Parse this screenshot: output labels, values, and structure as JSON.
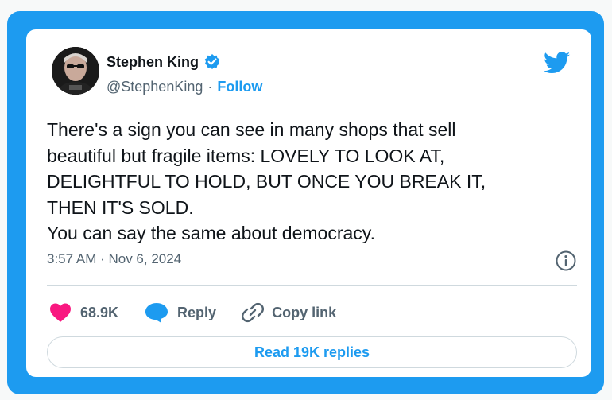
{
  "author": {
    "name": "Stephen King",
    "handle": "@StephenKing",
    "separator": "·",
    "follow_label": "Follow"
  },
  "tweet": {
    "lines": [
      "There's a sign you can see in many shops that sell",
      "beautiful but fragile items: LOVELY TO LOOK AT,",
      "DELIGHTFUL TO HOLD, BUT ONCE YOU BREAK IT,",
      "THEN IT'S SOLD.",
      "You can say the same about democracy."
    ],
    "timestamp": "3:57 AM · Nov 6, 2024"
  },
  "actions": {
    "likes": "68.9K",
    "reply_label": "Reply",
    "copy_link_label": "Copy link"
  },
  "read_replies_label": "Read 19K replies",
  "icons": {
    "verified": "verified-badge-icon",
    "brand": "twitter-bird-icon",
    "info": "info-icon",
    "like": "heart-icon",
    "reply": "speech-bubble-icon",
    "copy": "link-icon"
  },
  "colors": {
    "brand_blue": "#1d9bf0",
    "like_pink": "#f91880",
    "text": "#0f1419",
    "muted": "#536471"
  }
}
